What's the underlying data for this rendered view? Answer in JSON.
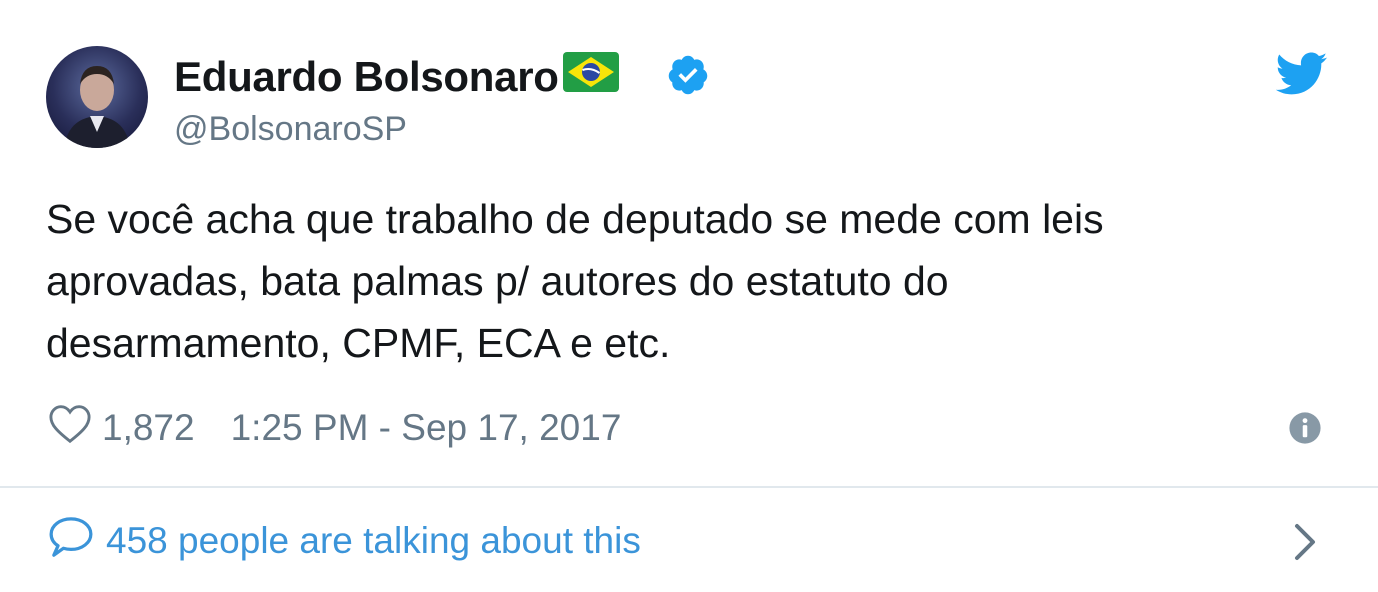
{
  "author": {
    "display_name": "Eduardo Bolsonaro",
    "handle": "@BolsonaroSP",
    "flag_icon": "brazil-flag-icon",
    "verified_icon": "verified-badge-icon"
  },
  "tweet": {
    "text_lines": [
      "Se você acha que trabalho de deputado se mede com leis",
      "aprovadas, bata palmas p/ autores do estatuto do",
      "desarmamento, CPMF, ECA e etc."
    ],
    "likes": "1,872",
    "timestamp": "1:25 PM - Sep 17, 2017"
  },
  "footer": {
    "talking_text": "458 people are talking about this"
  },
  "icons": {
    "brand": "twitter-bird-icon",
    "like": "heart-icon",
    "info": "info-icon",
    "reply": "speech-bubble-icon",
    "more": "chevron-right-icon"
  },
  "colors": {
    "twitter_blue": "#1da1f2",
    "verified_blue": "#1da1f2",
    "secondary_text": "#657786",
    "link_blue": "#3b94d9",
    "divider": "#e1e8ed"
  }
}
